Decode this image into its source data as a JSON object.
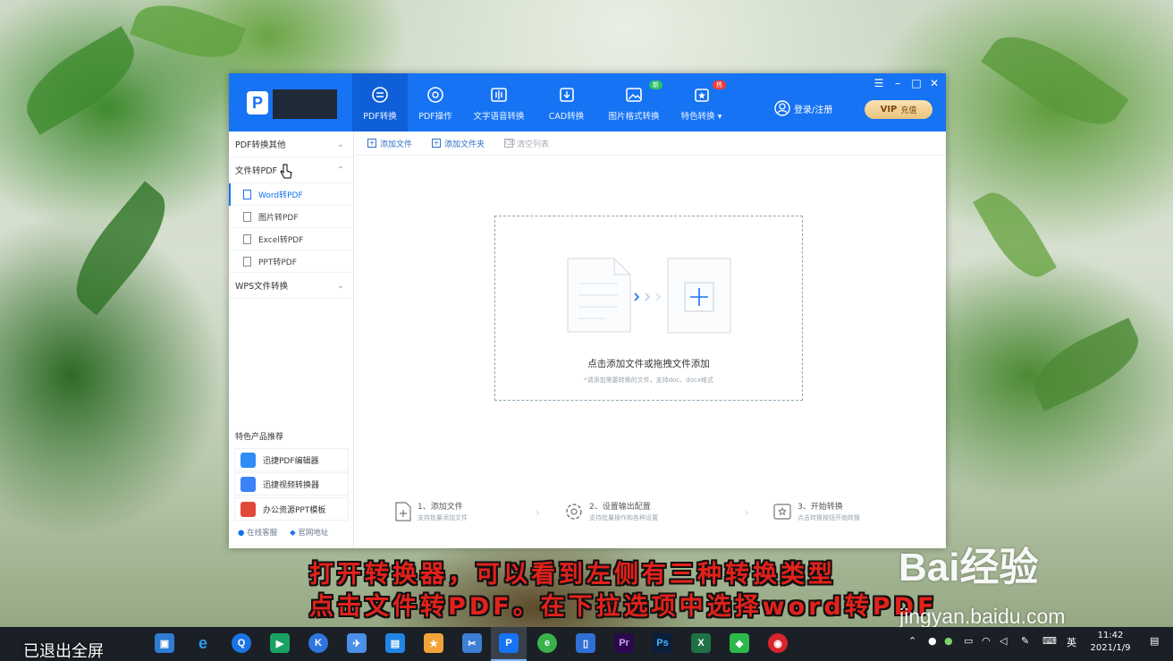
{
  "app": {
    "nav": [
      {
        "label": "PDF转换",
        "icon": "pdf-convert-icon",
        "active": true
      },
      {
        "label": "PDF操作",
        "icon": "pdf-operate-icon"
      },
      {
        "label": "文字语音转换",
        "icon": "voice-icon"
      },
      {
        "label": "CAD转换",
        "icon": "cad-icon"
      },
      {
        "label": "图片格式转换",
        "icon": "image-icon",
        "badge": "新"
      },
      {
        "label": "特色转换",
        "icon": "feature-icon",
        "badge": "热"
      }
    ],
    "login_label": "登录/注册",
    "vip_label": "VIP",
    "vip_sub": "充值",
    "sidebar": {
      "cat1": "PDF转换其他",
      "cat2": "文件转PDF",
      "items": [
        "Word转PDF",
        "图片转PDF",
        "Excel转PDF",
        "PPT转PDF"
      ],
      "cat3": "WPS文件转换",
      "rec_title": "特色产品推荐",
      "recs": [
        "迅捷PDF编辑器",
        "迅捷视频转换器",
        "办公资源PPT模板"
      ],
      "service": "在线客服",
      "website": "官网地址"
    },
    "toolbar": {
      "add_file": "添加文件",
      "add_folder": "添加文件夹",
      "clear": "清空列表"
    },
    "drop": {
      "text": "点击添加文件或拖拽文件添加",
      "hint": "*请添加需要转换的文件，支持doc、docx格式"
    },
    "steps": [
      {
        "title": "1、添加文件",
        "sub": "支持批量添加文件"
      },
      {
        "title": "2、设置输出配置",
        "sub": "支持批量操作和各种设置"
      },
      {
        "title": "3、开始转换",
        "sub": "点击转换按钮开始转换"
      }
    ]
  },
  "caption": {
    "line1": "打开转换器，可以看到左侧有三种转换类型",
    "line2": "点击文件转PDF。在下拉选项中选择word转PDF"
  },
  "watermark": {
    "brand": "Bai经验",
    "url": "jingyan.baidu.com"
  },
  "taskbar": {
    "exit_fullscreen": "已退出全屏",
    "ime": "英",
    "time": "11:42",
    "date": "2021/1/9"
  },
  "colors": {
    "brand_blue": "#1673f3",
    "caption_red": "#e3211b"
  }
}
